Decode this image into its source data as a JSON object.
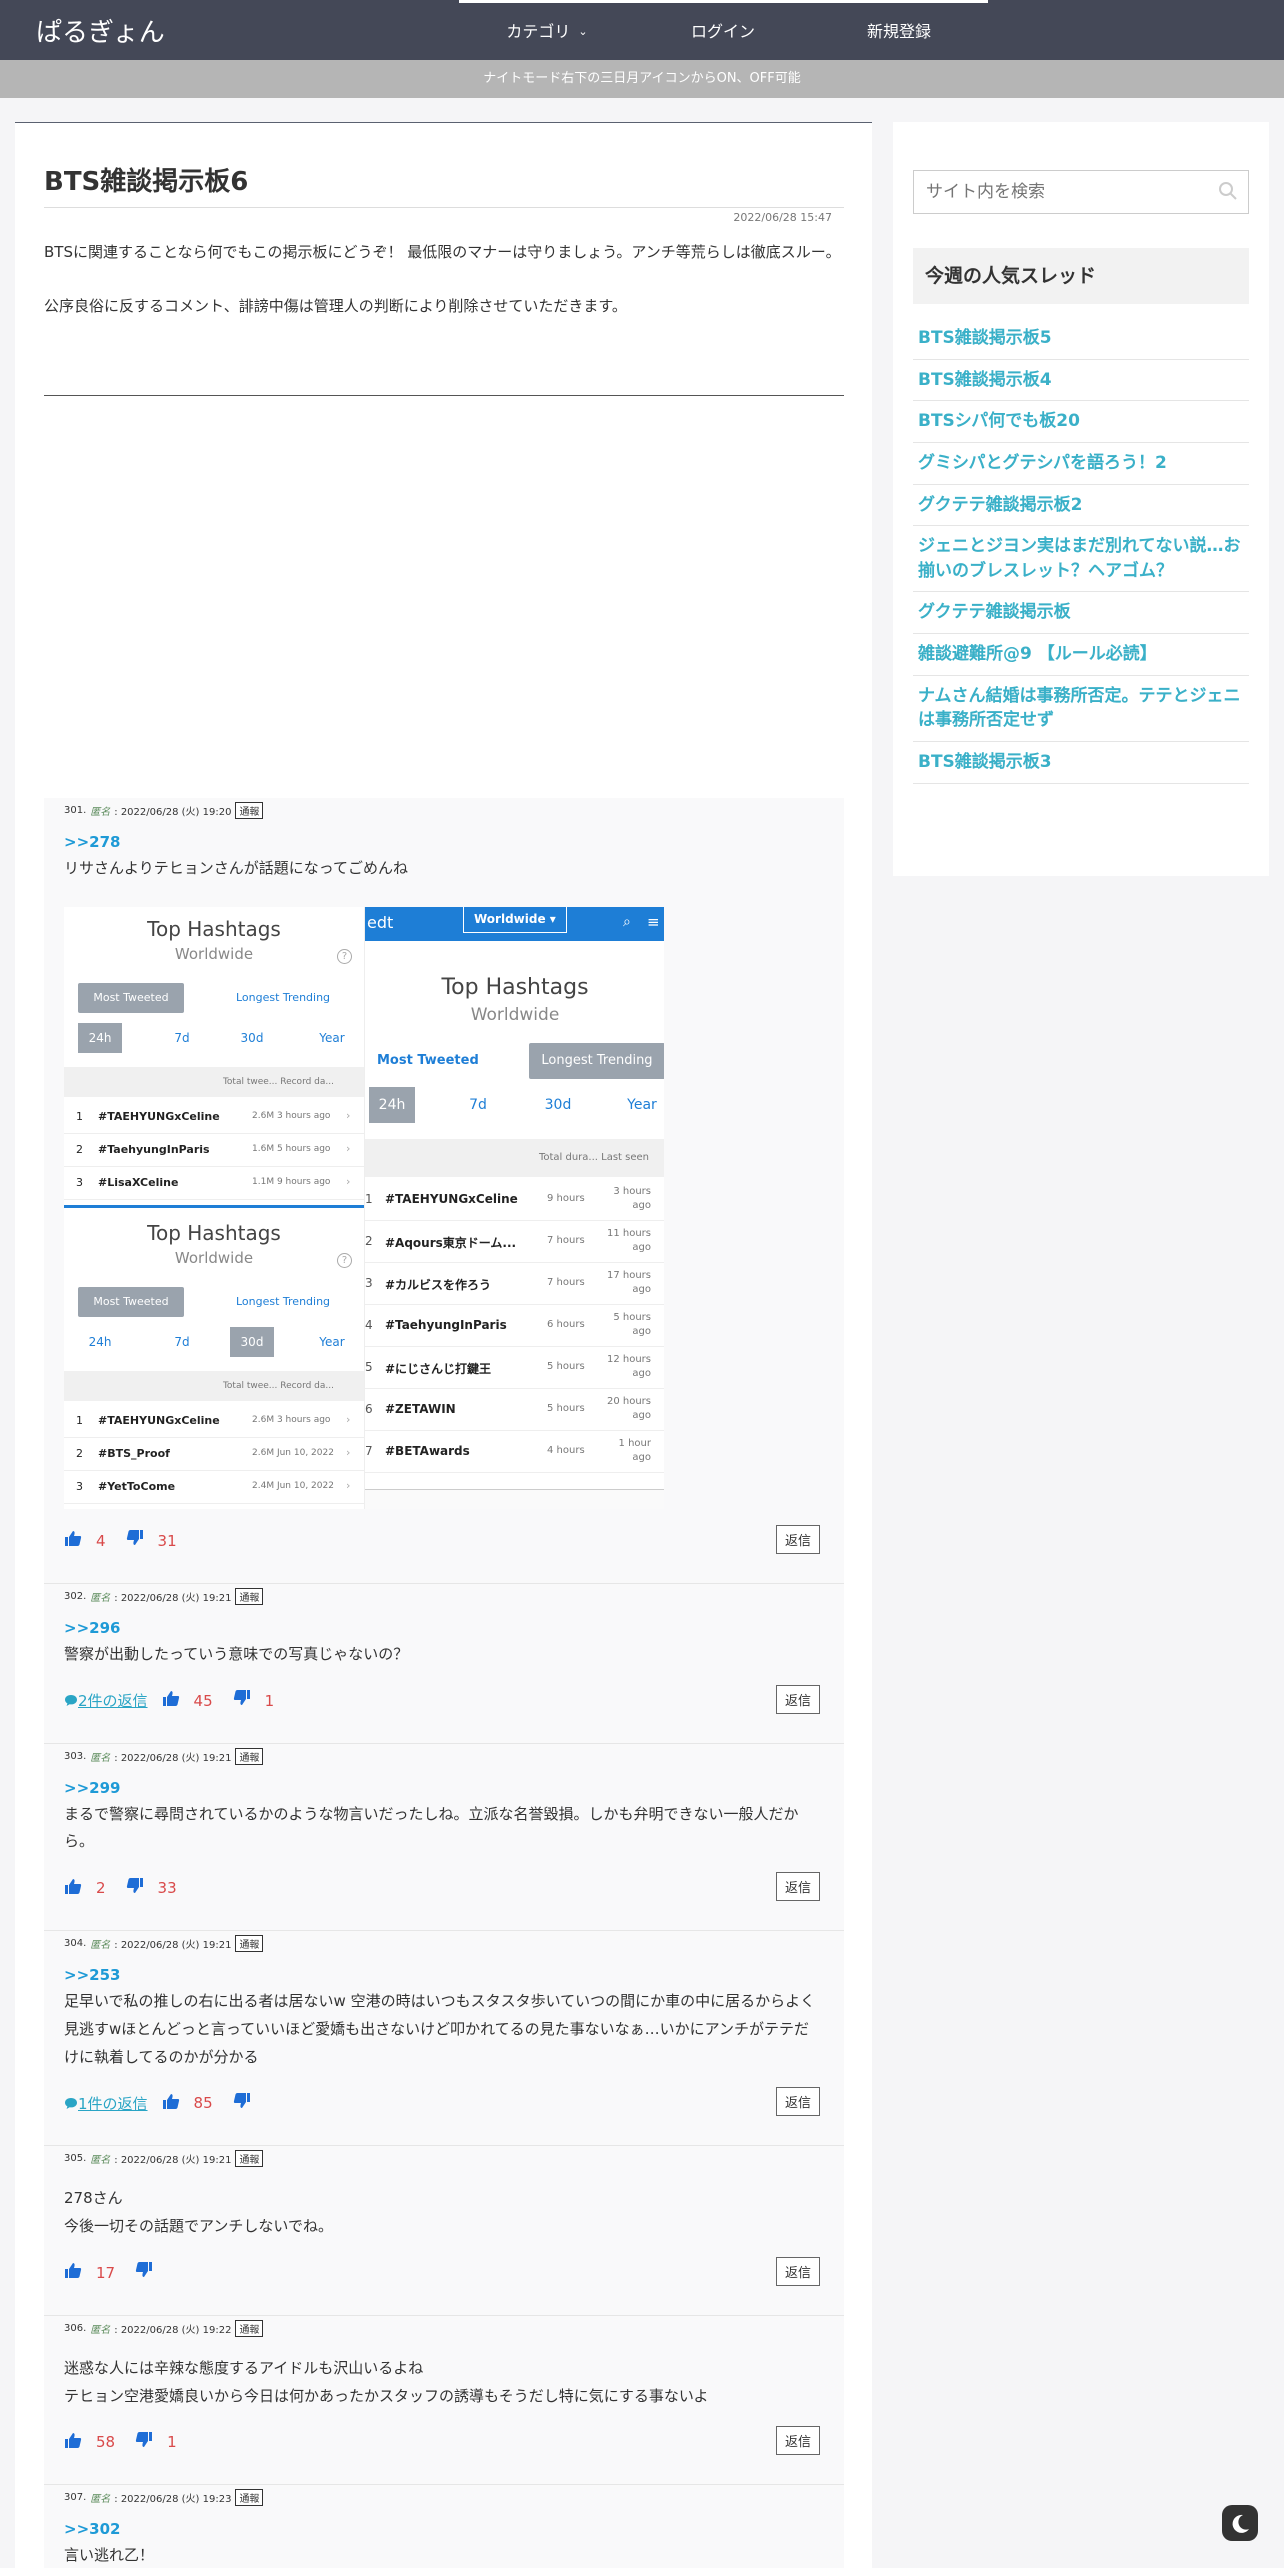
{
  "header": {
    "logo": "ぱるぎょん",
    "nav": [
      {
        "label": "カテゴリ",
        "has_caret": true
      },
      {
        "label": "ログイン"
      },
      {
        "label": "新規登録"
      }
    ],
    "notice": "ナイトモード右下の三日月アイコンからON、OFF可能"
  },
  "article": {
    "title": "BTS雑談掲示板6",
    "date": "2022/06/28 15:47",
    "intro": [
      "BTSに関連することなら何でもこの掲示板にどうぞ！ 最低限のマナーは守りましょう。アンチ等荒らしは徹底スルー。",
      "公序良俗に反するコメント、誹謗中傷は管理人の判断により削除させていただきます。"
    ]
  },
  "embedded_image": {
    "left": {
      "top_title": "Top Hashtags",
      "top_sub": "Worldwide",
      "btn_most": "Most Tweeted",
      "btn_longest": "Longest Trending",
      "periods": [
        "24h",
        "7d",
        "30d",
        "Year"
      ],
      "table_head": "Total twee...  Record da...",
      "rows_a": [
        {
          "n": "1",
          "tag": "#TAEHYUNGxCeline",
          "stat": "2.6M  3 hours ago"
        },
        {
          "n": "2",
          "tag": "#TaehyungInParis",
          "stat": "1.6M  5 hours ago"
        },
        {
          "n": "3",
          "tag": "#LisaXCeline",
          "stat": "1.1M  9 hours ago"
        }
      ],
      "bottom_title": "Top Hashtags",
      "bottom_sub": "Worldwide",
      "rows_b": [
        {
          "n": "1",
          "tag": "#TAEHYUNGxCeline",
          "stat": "2.6M  3 hours ago"
        },
        {
          "n": "2",
          "tag": "#BTS_Proof",
          "stat": "2.6M  Jun 10, 2022"
        },
        {
          "n": "3",
          "tag": "#YetToCome",
          "stat": "2.4M  Jun 10, 2022"
        }
      ]
    },
    "right": {
      "brand": "edt",
      "region": "Worldwide ▾",
      "title": "Top Hashtags",
      "sub": "Worldwide",
      "btn_most": "Most Tweeted",
      "btn_longest": "Longest Trending",
      "periods": [
        "24h",
        "7d",
        "30d",
        "Year"
      ],
      "table_head": "Total dura...   Last seen",
      "rows": [
        {
          "n": "1",
          "tag": "#TAEHYUNGxCeline",
          "dur": "9 hours",
          "seen": "3 hours ago"
        },
        {
          "n": "2",
          "tag": "#Aqours東京ドーム...",
          "dur": "7 hours",
          "seen": "11 hours ago"
        },
        {
          "n": "3",
          "tag": "#カルビスを作ろう",
          "dur": "7 hours",
          "seen": "17 hours ago"
        },
        {
          "n": "4",
          "tag": "#TaehyungInParis",
          "dur": "6 hours",
          "seen": "5 hours ago"
        },
        {
          "n": "5",
          "tag": "#にじさんじ打鍵王",
          "dur": "5 hours",
          "seen": "12 hours ago"
        },
        {
          "n": "6",
          "tag": "#ZETAWIN",
          "dur": "5 hours",
          "seen": "20 hours ago"
        },
        {
          "n": "7",
          "tag": "#BETAwards",
          "dur": "4 hours",
          "seen": "1 hour ago"
        }
      ]
    }
  },
  "comments": [
    {
      "no": "301.",
      "anon": "匿名",
      "time": ": 2022/06/28 (火) 19:20",
      "report": "通報",
      "anchor": ">>278",
      "body": "リサさんよりテヒョンさんが話題になってごめんね",
      "has_image": true,
      "replies": "",
      "up": "4",
      "down": "31",
      "reply": "返信"
    },
    {
      "no": "302.",
      "anon": "匿名",
      "time": ": 2022/06/28 (火) 19:21",
      "report": "通報",
      "anchor": ">>296",
      "body": "警察が出動したっていう意味での写真じゃないの？",
      "replies": "2件の返信",
      "up": "45",
      "down": "1",
      "reply": "返信"
    },
    {
      "no": "303.",
      "anon": "匿名",
      "time": ": 2022/06/28 (火) 19:21",
      "report": "通報",
      "anchor": ">>299",
      "body": "まるで警察に尋問されているかのような物言いだったしね。立派な名誉毀損。しかも弁明できない一般人だから。",
      "replies": "",
      "up": "2",
      "down": "33",
      "reply": "返信"
    },
    {
      "no": "304.",
      "anon": "匿名",
      "time": ": 2022/06/28 (火) 19:21",
      "report": "通報",
      "anchor": ">>253",
      "body": "足早いで私の推しの右に出る者は居ないw 空港の時はいつもスタスタ歩いていつの間にか車の中に居るからよく見逃すwほとんどっと言っていいほど愛嬌も出さないけど叩かれてるの見た事ないなぁ…いかにアンチがテテだけに執着してるのかが分かる",
      "replies": "1件の返信",
      "up": "85",
      "down": "",
      "reply": "返信"
    },
    {
      "no": "305.",
      "anon": "匿名",
      "time": ": 2022/06/28 (火) 19:21",
      "report": "通報",
      "anchor": "",
      "body": "278さん\n今後一切その話題でアンチしないでね。",
      "replies": "",
      "up": "17",
      "down": "",
      "reply": "返信"
    },
    {
      "no": "306.",
      "anon": "匿名",
      "time": ": 2022/06/28 (火) 19:22",
      "report": "通報",
      "anchor": "",
      "body": "迷惑な人には辛辣な態度するアイドルも沢山いるよね\nテヒョン空港愛嬌良いから今日は何かあったかスタッフの誘導もそうだし特に気にする事ないよ",
      "replies": "",
      "up": "58",
      "down": "1",
      "reply": "返信"
    },
    {
      "no": "307.",
      "anon": "匿名",
      "time": ": 2022/06/28 (火) 19:23",
      "report": "通報",
      "anchor": ">>302",
      "body": "言い逃れ乙！",
      "replies": "",
      "up": "",
      "down": "",
      "reply": ""
    }
  ],
  "sidebar": {
    "search_placeholder": "サイト内を検索",
    "popular_title": "今週の人気スレッド",
    "popular": [
      "BTS雑談掲示板5",
      "BTS雑談掲示板4",
      "BTSシパ何でも板20",
      "グミシパとグテシパを語ろう！2",
      "グクテテ雑談掲示板2",
      "ジェニとジヨン実はまだ別れてない説…お揃いのブレスレット？ヘアゴム？",
      "グクテテ雑談掲示板",
      "雑談避難所@9 【ルール必読】",
      "ナムさん結婚は事務所否定。テテとジェニは事務所否定せず",
      "BTS雑談掲示板3"
    ]
  },
  "colors": {
    "header_bg": "#444857",
    "link": "#3ab0c8",
    "anchor": "#1e9ad6",
    "count": "#d94a4a",
    "thumb": "#1e6dd6"
  }
}
